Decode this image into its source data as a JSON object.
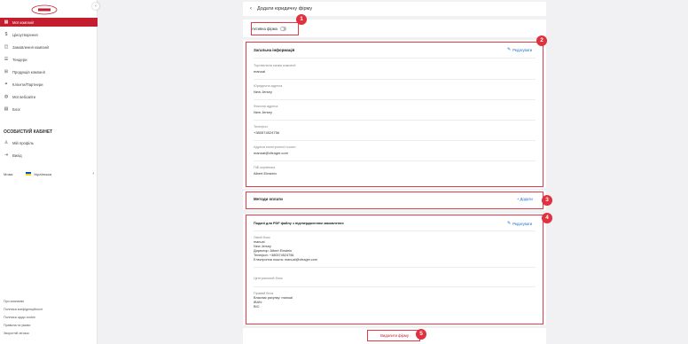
{
  "sidebar": {
    "logo_text": "VITRAGER.COM",
    "collapse_icon": "chevron-left-icon",
    "items": [
      {
        "label": "Мої компанії",
        "icon": "building-icon",
        "active": true
      },
      {
        "label": "Ціноутворення",
        "icon": "dollar-icon",
        "active": false
      },
      {
        "label": "Замовлення компанії",
        "icon": "bag-icon",
        "active": false
      },
      {
        "label": "Тендери",
        "icon": "list-icon",
        "active": false
      },
      {
        "label": "Продукція компанії",
        "icon": "grid-icon",
        "active": false
      },
      {
        "label": "Клієнти/Партнери",
        "icon": "handshake-icon",
        "active": false
      },
      {
        "label": "Мої вебсайти",
        "icon": "globe-icon",
        "active": false
      },
      {
        "label": "Блог",
        "icon": "news-icon",
        "active": false
      }
    ],
    "cabinet_title": "ОСОБИСТИЙ КАБІНЕТ",
    "cabinet_items": [
      {
        "label": "Мій профіль",
        "icon": "user-icon"
      },
      {
        "label": "Вихід",
        "icon": "logout-icon"
      }
    ],
    "language_label": "Мова:",
    "language_value": "Українська",
    "footer_links": [
      "Про компанію",
      "Політика конфіденційності",
      "Політика щодо cookie",
      "Правила та умови",
      "Зворотній зв'язок"
    ]
  },
  "topbar": {
    "title": "Додати юридичну фірму"
  },
  "active_firm": {
    "label": "Активна фірма"
  },
  "general": {
    "title": "Загальна інформація",
    "edit_label": "Редагувати",
    "fields": [
      {
        "label": "Торгівельна назва компанії",
        "value": "manual"
      },
      {
        "label": "Юридична адреса",
        "value": "New Jersey"
      },
      {
        "label": "Фізична адреса",
        "value": "New Jersey"
      },
      {
        "label": "Телефон",
        "value": "+380574524756"
      },
      {
        "label": "Адреса електронної пошти",
        "value": "manual@vitrager.com"
      },
      {
        "label": "ПІБ керівника",
        "value": "Albert Einstein"
      }
    ]
  },
  "payment": {
    "title": "Методи оплати",
    "add_label": "+ Додати"
  },
  "pdf": {
    "title": "Подані для PDF файлу з підтвердженням замовлення",
    "edit_label": "Редагувати",
    "left_block_label": "Лівий блок",
    "left_block_lines": [
      "manual",
      "New Jersey",
      "Директор: Albert Einstein",
      "Телефон: +380574524756",
      "Електронна пошта: manual@vitrager.com"
    ],
    "center_block_label": "Центральний блок",
    "right_block_label": "Правий блок",
    "right_block_lines": [
      "Власник рахунку: manual",
      "IBAN:",
      "BIC:"
    ]
  },
  "delete": {
    "label": "Видалити фірму"
  },
  "badges": [
    "1",
    "2",
    "3",
    "4",
    "5"
  ],
  "colors": {
    "brand_red": "#c41e2e",
    "annotation_red": "#e0313f",
    "link_blue": "#1a6dc9"
  }
}
